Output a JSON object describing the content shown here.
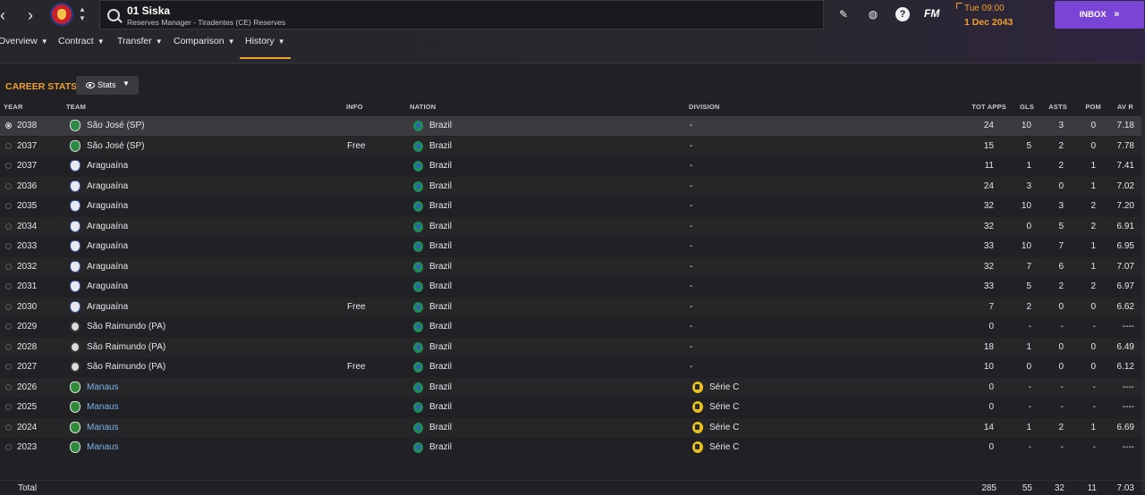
{
  "header": {
    "player_name": "01 Siska",
    "player_sub": "Reserves Manager - Tiradentes (CE) Reserves",
    "time": "Tue 09:00",
    "date": "1 Dec 2043",
    "fm_label": "FM",
    "help_label": "?",
    "inbox_label": "INBOX"
  },
  "tabs": [
    {
      "label": "Overview"
    },
    {
      "label": "Contract"
    },
    {
      "label": "Transfer"
    },
    {
      "label": "Comparison"
    },
    {
      "label": "History"
    }
  ],
  "section": {
    "title": "CAREER STATS",
    "stats_label": "Stats"
  },
  "columns": {
    "year": "YEAR",
    "team": "TEAM",
    "info": "INFO",
    "nation": "NATION",
    "division": "DIVISION",
    "apps": "TOT APPS",
    "gls": "GLS",
    "asts": "ASTS",
    "pom": "POM",
    "avr": "AV R"
  },
  "rows": [
    {
      "year": "2038",
      "team": "São José (SP)",
      "crest": "sj",
      "info": "",
      "nation": "Brazil",
      "division": "-",
      "apps": "24",
      "gls": "10",
      "asts": "3",
      "pom": "0",
      "avr": "7.18"
    },
    {
      "year": "2037",
      "team": "São José (SP)",
      "crest": "sj",
      "info": "Free",
      "nation": "Brazil",
      "division": "-",
      "apps": "15",
      "gls": "5",
      "asts": "2",
      "pom": "0",
      "avr": "7.78"
    },
    {
      "year": "2037",
      "team": "Araguaína",
      "crest": "ar",
      "info": "",
      "nation": "Brazil",
      "division": "-",
      "apps": "11",
      "gls": "1",
      "asts": "2",
      "pom": "1",
      "avr": "7.41"
    },
    {
      "year": "2036",
      "team": "Araguaína",
      "crest": "ar",
      "info": "",
      "nation": "Brazil",
      "division": "-",
      "apps": "24",
      "gls": "3",
      "asts": "0",
      "pom": "1",
      "avr": "7.02"
    },
    {
      "year": "2035",
      "team": "Araguaína",
      "crest": "ar",
      "info": "",
      "nation": "Brazil",
      "division": "-",
      "apps": "32",
      "gls": "10",
      "asts": "3",
      "pom": "2",
      "avr": "7.20"
    },
    {
      "year": "2034",
      "team": "Araguaína",
      "crest": "ar",
      "info": "",
      "nation": "Brazil",
      "division": "-",
      "apps": "32",
      "gls": "0",
      "asts": "5",
      "pom": "2",
      "avr": "6.91"
    },
    {
      "year": "2033",
      "team": "Araguaína",
      "crest": "ar",
      "info": "",
      "nation": "Brazil",
      "division": "-",
      "apps": "33",
      "gls": "10",
      "asts": "7",
      "pom": "1",
      "avr": "6.95"
    },
    {
      "year": "2032",
      "team": "Araguaína",
      "crest": "ar",
      "info": "",
      "nation": "Brazil",
      "division": "-",
      "apps": "32",
      "gls": "7",
      "asts": "6",
      "pom": "1",
      "avr": "7.07"
    },
    {
      "year": "2031",
      "team": "Araguaína",
      "crest": "ar",
      "info": "",
      "nation": "Brazil",
      "division": "-",
      "apps": "33",
      "gls": "5",
      "asts": "2",
      "pom": "2",
      "avr": "6.97"
    },
    {
      "year": "2030",
      "team": "Araguaína",
      "crest": "ar",
      "info": "Free",
      "nation": "Brazil",
      "division": "-",
      "apps": "7",
      "gls": "2",
      "asts": "0",
      "pom": "0",
      "avr": "6.62"
    },
    {
      "year": "2029",
      "team": "São Raimundo (PA)",
      "crest": "sr",
      "info": "",
      "nation": "Brazil",
      "division": "-",
      "apps": "0",
      "gls": "-",
      "asts": "-",
      "pom": "-",
      "avr": "----"
    },
    {
      "year": "2028",
      "team": "São Raimundo (PA)",
      "crest": "sr",
      "info": "",
      "nation": "Brazil",
      "division": "-",
      "apps": "18",
      "gls": "1",
      "asts": "0",
      "pom": "0",
      "avr": "6.49"
    },
    {
      "year": "2027",
      "team": "São Raimundo (PA)",
      "crest": "sr",
      "info": "Free",
      "nation": "Brazil",
      "division": "-",
      "apps": "10",
      "gls": "0",
      "asts": "0",
      "pom": "0",
      "avr": "6.12"
    },
    {
      "year": "2026",
      "team": "Manaus",
      "crest": "ma",
      "link": true,
      "info": "",
      "nation": "Brazil",
      "division": "Série C",
      "apps": "0",
      "gls": "-",
      "asts": "-",
      "pom": "-",
      "avr": "----"
    },
    {
      "year": "2025",
      "team": "Manaus",
      "crest": "ma",
      "link": true,
      "info": "",
      "nation": "Brazil",
      "division": "Série C",
      "apps": "0",
      "gls": "-",
      "asts": "-",
      "pom": "-",
      "avr": "----"
    },
    {
      "year": "2024",
      "team": "Manaus",
      "crest": "ma",
      "link": true,
      "info": "",
      "nation": "Brazil",
      "division": "Série C",
      "apps": "14",
      "gls": "1",
      "asts": "2",
      "pom": "1",
      "avr": "6.69"
    },
    {
      "year": "2023",
      "team": "Manaus",
      "crest": "ma",
      "link": true,
      "info": "",
      "nation": "Brazil",
      "division": "Série C",
      "apps": "0",
      "gls": "-",
      "asts": "-",
      "pom": "-",
      "avr": "----"
    }
  ],
  "total": {
    "label": "Total",
    "apps": "285",
    "gls": "55",
    "asts": "32",
    "pom": "11",
    "avr": "7.03"
  }
}
